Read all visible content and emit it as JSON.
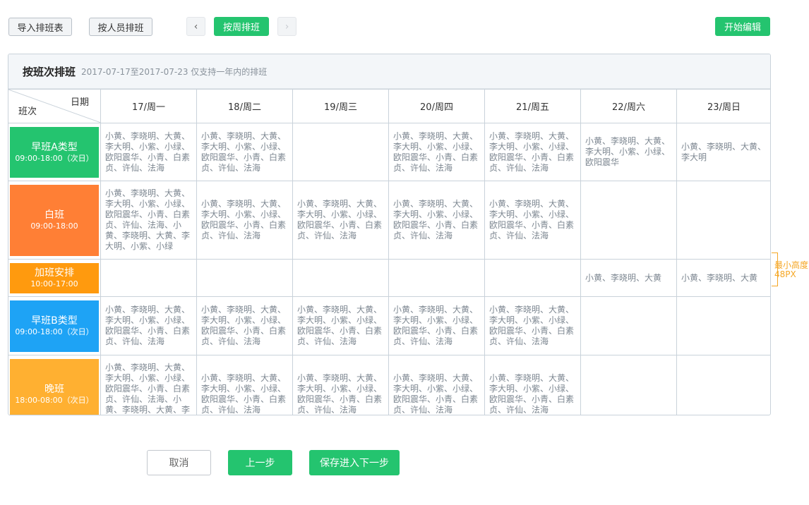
{
  "toolbar": {
    "import_label": "导入排班表",
    "by_person_label": "按人员排班",
    "prev_label": "‹",
    "by_week_label": "按周排班",
    "next_label": "›",
    "start_edit_label": "开始编辑"
  },
  "panel": {
    "title": "按班次排班",
    "subtitle": "2017-07-17至2017-07-23  仅支持一年内的排班"
  },
  "table": {
    "corner_date": "日期",
    "corner_shift": "班次",
    "days": [
      "17/周一",
      "18/周二",
      "19/周三",
      "20/周四",
      "21/周五",
      "22/周六",
      "23/周日"
    ],
    "rows": [
      {
        "name": "早班A类型",
        "time": "09:00-18:00（次日）",
        "color": "#24c46f",
        "cells": [
          "小黄、李晓明、大黄、李大明、小紫、小绿、欧阳震华、小青、白素贞、许仙、法海",
          "小黄、李晓明、大黄、李大明、小紫、小绿、欧阳震华、小青、白素贞、许仙、法海",
          "",
          "小黄、李晓明、大黄、李大明、小紫、小绿、欧阳震华、小青、白素贞、许仙、法海",
          "小黄、李晓明、大黄、李大明、小紫、小绿、欧阳震华、小青、白素贞、许仙、法海",
          "小黄、李晓明、大黄、李大明、小紫、小绿、欧阳震华",
          "小黄、李晓明、大黄、李大明"
        ]
      },
      {
        "name": "白班",
        "time": "09:00-18:00",
        "color": "#ff7f35",
        "cells": [
          "小黄、李晓明、大黄、李大明、小紫、小绿、欧阳震华、小青、白素贞、许仙、法海、小黄、李晓明、大黄、李大明、小紫、小绿",
          "小黄、李晓明、大黄、李大明、小紫、小绿、欧阳震华、小青、白素贞、许仙、法海",
          "小黄、李晓明、大黄、李大明、小紫、小绿、欧阳震华、小青、白素贞、许仙、法海",
          "小黄、李晓明、大黄、李大明、小紫、小绿、欧阳震华、小青、白素贞、许仙、法海",
          "小黄、李晓明、大黄、李大明、小紫、小绿、欧阳震华、小青、白素贞、许仙、法海",
          "",
          ""
        ]
      },
      {
        "name": "加班安排",
        "time": "10:00-17:00",
        "color": "#ff9a0e",
        "cells": [
          "",
          "",
          "",
          "",
          "",
          "小黄、李晓明、大黄",
          "小黄、李晓明、大黄"
        ]
      },
      {
        "name": "早班B类型",
        "time": "09:00-18:00（次日）",
        "color": "#1ea3f5",
        "cells": [
          "小黄、李晓明、大黄、李大明、小紫、小绿、欧阳震华、小青、白素贞、许仙、法海",
          "小黄、李晓明、大黄、李大明、小紫、小绿、欧阳震华、小青、白素贞、许仙、法海",
          "小黄、李晓明、大黄、李大明、小紫、小绿、欧阳震华、小青、白素贞、许仙、法海",
          "小黄、李晓明、大黄、李大明、小紫、小绿、欧阳震华、小青、白素贞、许仙、法海",
          "小黄、李晓明、大黄、李大明、小紫、小绿、欧阳震华、小青、白素贞、许仙、法海",
          "",
          ""
        ]
      },
      {
        "name": "晚班",
        "time": "18:00-08:00（次日）",
        "color": "#ffb031",
        "cells": [
          "小黄、李晓明、大黄、李大明、小紫、小绿、欧阳震华、小青、白素贞、许仙、法海、小黄、李晓明、大黄、李大明、小紫、小绿",
          "小黄、李晓明、大黄、李大明、小紫、小绿、欧阳震华、小青、白素贞、许仙、法海",
          "小黄、李晓明、大黄、李大明、小紫、小绿、欧阳震华、小青、白素贞、许仙、法海",
          "小黄、李晓明、大黄、李大明、小紫、小绿、欧阳震华、小青、白素贞、许仙、法海",
          "小黄、李晓明、大黄、李大明、小紫、小绿、欧阳震华、小青、白素贞、许仙、法海",
          "",
          ""
        ]
      }
    ]
  },
  "annotation": {
    "line1": "最小高度",
    "line2": "48PX",
    "color": "#f5a623"
  },
  "footer": {
    "cancel_label": "取消",
    "prev_step_label": "上一步",
    "save_next_label": "保存进入下一步"
  },
  "colors": {
    "accent": "#24c46f",
    "border": "#c9d2da"
  }
}
